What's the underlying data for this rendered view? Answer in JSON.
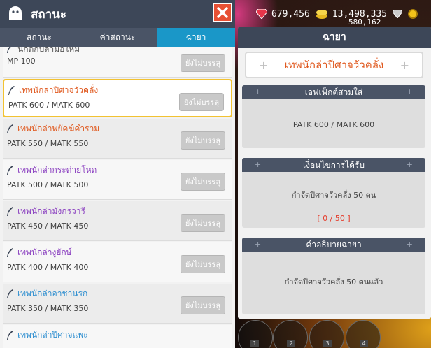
{
  "resources": {
    "gems": "679,456",
    "coins": "13,498,335",
    "coins_sub": "580,162"
  },
  "header": {
    "title": "สถานะ"
  },
  "tabs": [
    {
      "label": "สถานะ",
      "active": false
    },
    {
      "label": "ค่าสถานะ",
      "active": false
    },
    {
      "label": "ฉายา",
      "active": true
    }
  ],
  "titles_list": [
    {
      "name": "นักตกปลามือใหม่",
      "stat": "MP 100",
      "button": "ยังไม่บรรลุ",
      "color": "#555555"
    },
    {
      "name": "เทพนักล่าปีศาจวัวคลั่ง",
      "stat": "PATK 600 / MATK 600",
      "button": "ยังไม่บรรลุ",
      "color": "#e05a20"
    },
    {
      "name": "เทพนักล่าพยัคฆ์คำราม",
      "stat": "PATK 550 / MATK 550",
      "button": "ยังไม่บรรลุ",
      "color": "#e05a20"
    },
    {
      "name": "เทพนักล่ากระต่ายโหด",
      "stat": "PATK 500 / MATK 500",
      "button": "ยังไม่บรรลุ",
      "color": "#8a3fc0"
    },
    {
      "name": "เทพนักล่ามังกรวารี",
      "stat": "PATK 450 / MATK 450",
      "button": "ยังไม่บรรลุ",
      "color": "#8a3fc0"
    },
    {
      "name": "เทพนักล่างูยักษ์",
      "stat": "PATK 400 / MATK 400",
      "button": "ยังไม่บรรลุ",
      "color": "#8a3fc0"
    },
    {
      "name": "เทพนักล่าอาชานรก",
      "stat": "PATK 350 / MATK 350",
      "button": "ยังไม่บรรลุ",
      "color": "#2f8fd0"
    },
    {
      "name": "เทพนักล่าปีศาจแพะ",
      "stat": "",
      "button": "",
      "color": "#2f8fd0"
    }
  ],
  "detail": {
    "panel_title": "ฉายา",
    "selected_title": "เทพนักล่าปีศาจวัวคลั่ง",
    "effect_header": "เอฟเฟ็กต์สวมใส่",
    "effect_text": "PATK 600 / MATK 600",
    "condition_header": "เงื่อนไขการได้รับ",
    "condition_text": "กำจัดปีศาจวัวคลั่ง 50 ตน",
    "condition_progress": "[ 0 / 50 ]",
    "desc_header": "คำอธิบายฉายา",
    "desc_text": "กำจัดปีศาจวัวคลั่ง 50 ตนแล้ว"
  },
  "skill_slots": [
    "1",
    "2",
    "3",
    "4"
  ],
  "colors": {
    "header": "#3d4758",
    "tab_active": "#1a97c8",
    "close": "#e65034",
    "selected_border": "#f2c232",
    "progress": "#e53b2a"
  }
}
